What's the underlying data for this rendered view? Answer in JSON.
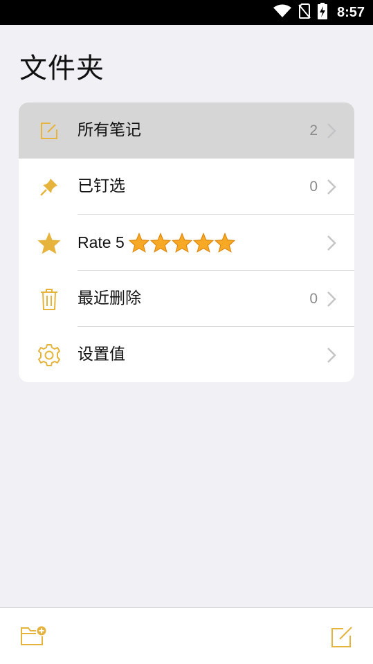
{
  "status_bar": {
    "time": "8:57",
    "icons": [
      "wifi-icon",
      "no-sim-icon",
      "battery-charging-icon"
    ]
  },
  "header": {
    "title": "文件夹"
  },
  "folders": [
    {
      "label": "所有笔记",
      "count": "2",
      "icon": "note-edit-icon",
      "selected": true
    },
    {
      "label": "已钉选",
      "count": "0",
      "icon": "pin-icon",
      "selected": false
    },
    {
      "label": "Rate 5",
      "count": "",
      "icon": "star-icon",
      "stars": 5,
      "selected": false
    },
    {
      "label": "最近删除",
      "count": "0",
      "icon": "trash-icon",
      "selected": false
    },
    {
      "label": "设置值",
      "count": "",
      "icon": "gear-icon",
      "selected": false
    }
  ],
  "toolbar": {
    "left_icon": "new-folder-icon",
    "right_icon": "compose-icon"
  },
  "colors": {
    "accent": "#e6b43c",
    "star": "#f5a623",
    "background": "#f0f0f5",
    "selected_row": "#d6d6d6"
  }
}
